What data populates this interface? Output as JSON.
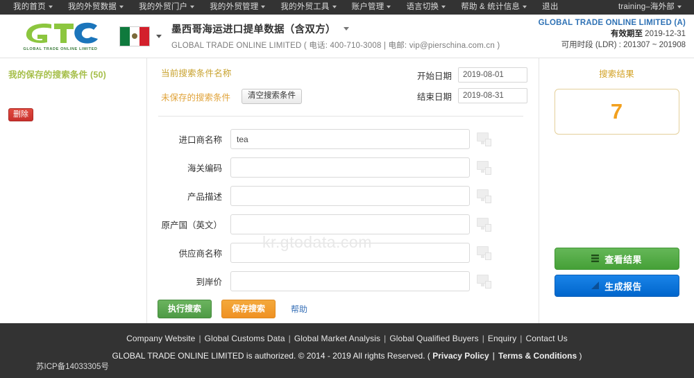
{
  "topnav": {
    "items": [
      {
        "label": "我的首页",
        "caret": true
      },
      {
        "label": "我的外贸数据",
        "caret": true
      },
      {
        "label": "我的外贸门户",
        "caret": true
      },
      {
        "label": "我的外贸管理",
        "caret": true
      },
      {
        "label": "我的外贸工具",
        "caret": true
      },
      {
        "label": "账户管理",
        "caret": true
      },
      {
        "label": "语言切换",
        "caret": true
      },
      {
        "label": "帮助 & 统计信息",
        "caret": true
      },
      {
        "label": "退出",
        "caret": false
      }
    ],
    "user": "training–海外部"
  },
  "header": {
    "logo_text": "GTO",
    "logo_sub": "GLOBAL TRADE ONLINE LIMITED",
    "flag": "mexico-flag",
    "title": "墨西哥海运进口提单数据（含双方）",
    "subtitle": "GLOBAL TRADE ONLINE LIMITED ( 电话:  400-710-3008 | 电邮:  vip@pierschina.com.cn )",
    "account_name": "GLOBAL TRADE ONLINE LIMITED (A)",
    "valid_label": "有效期至",
    "valid_value": "2019-12-31",
    "ldr": "可用时段 (LDR) : 201307 ~ 201908"
  },
  "sidebar": {
    "saved_title": "我的保存的搜索条件 (50)",
    "delete_label": "删除"
  },
  "form": {
    "current_condition_title": "当前搜索条件名称",
    "unsaved_label": "未保存的搜索条件",
    "clear_label": "清空搜索条件",
    "start_date_label": "开始日期",
    "start_date_value": "2019-08-01",
    "end_date_label": "结束日期",
    "end_date_value": "2019-08-31",
    "fields": [
      {
        "label": "进口商名称",
        "value": "tea",
        "placeholder": ""
      },
      {
        "label": "海关编码",
        "value": "",
        "placeholder": ""
      },
      {
        "label": "产品描述",
        "value": "",
        "placeholder": ""
      },
      {
        "label": "原产国（英文）",
        "value": "",
        "placeholder": ""
      },
      {
        "label": "供应商名称",
        "value": "",
        "placeholder": ""
      },
      {
        "label": "到岸价",
        "value": "",
        "placeholder": ""
      }
    ],
    "search_label": "执行搜索",
    "save_label": "保存搜索",
    "help_label": "帮助"
  },
  "results": {
    "title": "搜索结果",
    "count": "7",
    "view_label": "查看结果",
    "report_label": "生成报告"
  },
  "watermark": "kr.gtodata.com",
  "footer": {
    "icp": "苏ICP备14033305号",
    "links": [
      "Company Website",
      "Global Customs Data",
      "Global Market Analysis",
      "Global Qualified Buyers",
      "Enquiry",
      "Contact Us"
    ],
    "copyright": "GLOBAL TRADE ONLINE LIMITED is authorized. © 2014 - 2019 All rights Reserved.  (",
    "privacy": "Privacy Policy",
    "terms": "Terms & Conditions",
    "close_paren": ")"
  },
  "colors": {
    "nav_bg": "#333333",
    "accent_green": "#4e9a45",
    "accent_orange": "#ef9123",
    "accent_blue": "#0066cc",
    "result_number": "#f2a01e",
    "saved_title": "#a6bf4a",
    "delete_red": "#c9302c",
    "link_blue": "#2f72b5"
  }
}
